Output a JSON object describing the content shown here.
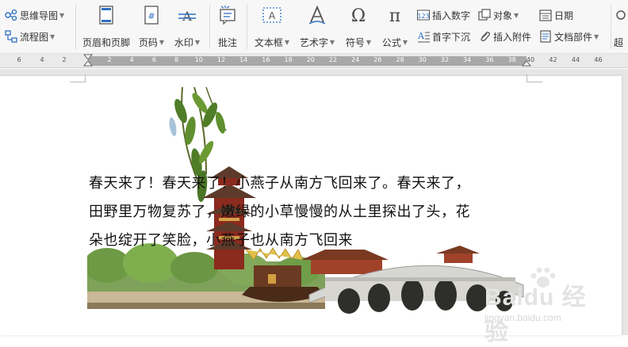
{
  "ribbon": {
    "mindmap_label": "思维导图",
    "flowchart_label": "流程图",
    "header_footer_label": "页眉和页脚",
    "page_number_label": "页码",
    "watermark_label": "水印",
    "comment_label": "批注",
    "textbox_label": "文本框",
    "wordart_label": "艺术字",
    "symbol_label": "符号",
    "formula_label": "公式",
    "insert_number_label": "插入数字",
    "drop_cap_label": "首字下沉",
    "object_label": "对象",
    "attachment_label": "插入附件",
    "date_label": "日期",
    "doc_parts_label": "文档部件",
    "hyperlink_label": "超"
  },
  "ruler": {
    "left_numbers": [
      "6",
      "4",
      "2"
    ],
    "track_numbers": [
      "2",
      "4",
      "6",
      "8",
      "10",
      "12",
      "14",
      "16",
      "18",
      "20",
      "22",
      "24",
      "26",
      "28",
      "30",
      "32",
      "34",
      "36",
      "38"
    ],
    "right_numbers": [
      "40",
      "42",
      "44",
      "46"
    ]
  },
  "document": {
    "body_text": "春天来了！春天来了！小燕子从南方飞回来了。春天来了，\n田野里万物复苏了，嫩绿的小草慢慢的从土里探出了头，花\n朵也绽开了笑脸，小燕子也从南方飞回来"
  },
  "watermark": {
    "brand": "Baidu 经验",
    "url": "jingyan.baidu.com"
  },
  "colors": {
    "ribbon_bg": "#f7f7f7",
    "accent_blue": "#2f6fc2",
    "ruler_track": "#a8a8a8",
    "page_bg": "#ffffff"
  }
}
